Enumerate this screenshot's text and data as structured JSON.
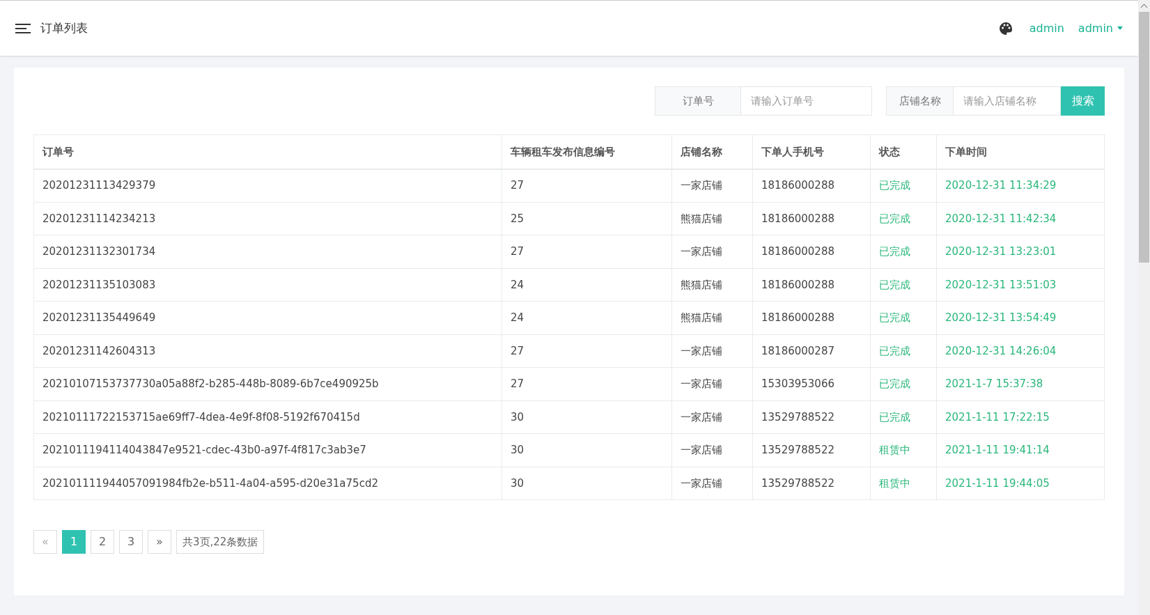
{
  "header": {
    "title": "订单列表",
    "links": [
      "admin"
    ],
    "user_menu": "admin"
  },
  "search": {
    "fields": [
      {
        "label": "订单号",
        "placeholder": "请输入订单号"
      },
      {
        "label": "店铺名称",
        "placeholder": "请输入店铺名称"
      }
    ],
    "button": "搜索"
  },
  "table": {
    "columns": [
      "订单号",
      "车辆租车发布信息编号",
      "店铺名称",
      "下单人手机号",
      "状态",
      "下单时间"
    ],
    "rows": [
      [
        "20201231113429379",
        "27",
        "一家店铺",
        "18186000288",
        "已完成",
        "2020-12-31 11:34:29"
      ],
      [
        "20201231114234213",
        "25",
        "熊猫店铺",
        "18186000288",
        "已完成",
        "2020-12-31 11:42:34"
      ],
      [
        "20201231132301734",
        "27",
        "一家店铺",
        "18186000288",
        "已完成",
        "2020-12-31 13:23:01"
      ],
      [
        "20201231135103083",
        "24",
        "熊猫店铺",
        "18186000288",
        "已完成",
        "2020-12-31 13:51:03"
      ],
      [
        "20201231135449649",
        "24",
        "熊猫店铺",
        "18186000288",
        "已完成",
        "2020-12-31 13:54:49"
      ],
      [
        "20201231142604313",
        "27",
        "一家店铺",
        "18186000287",
        "已完成",
        "2020-12-31 14:26:04"
      ],
      [
        "20210107153737730a05a88f2-b285-448b-8089-6b7ce490925b",
        "27",
        "一家店铺",
        "15303953066",
        "已完成",
        "2021-1-7 15:37:38"
      ],
      [
        "20210111722153715ae69ff7-4dea-4e9f-8f08-5192f670415d",
        "30",
        "一家店铺",
        "13529788522",
        "已完成",
        "2021-1-11 17:22:15"
      ],
      [
        "2021011194114043847e9521-cdec-43b0-a97f-4f817c3ab3e7",
        "30",
        "一家店铺",
        "13529788522",
        "租赁中",
        "2021-1-11 19:41:14"
      ],
      [
        "202101111944057091984fb2e-b511-4a04-a595-d20e31a75cd2",
        "30",
        "一家店铺",
        "13529788522",
        "租赁中",
        "2021-1-11 19:44:05"
      ]
    ]
  },
  "pagination": {
    "prev": "«",
    "pages": [
      {
        "label": "1",
        "selected": true
      },
      {
        "label": "2",
        "selected": false
      },
      {
        "label": "3",
        "selected": false
      }
    ],
    "next": "»",
    "summary": "共3页,22条数据"
  }
}
